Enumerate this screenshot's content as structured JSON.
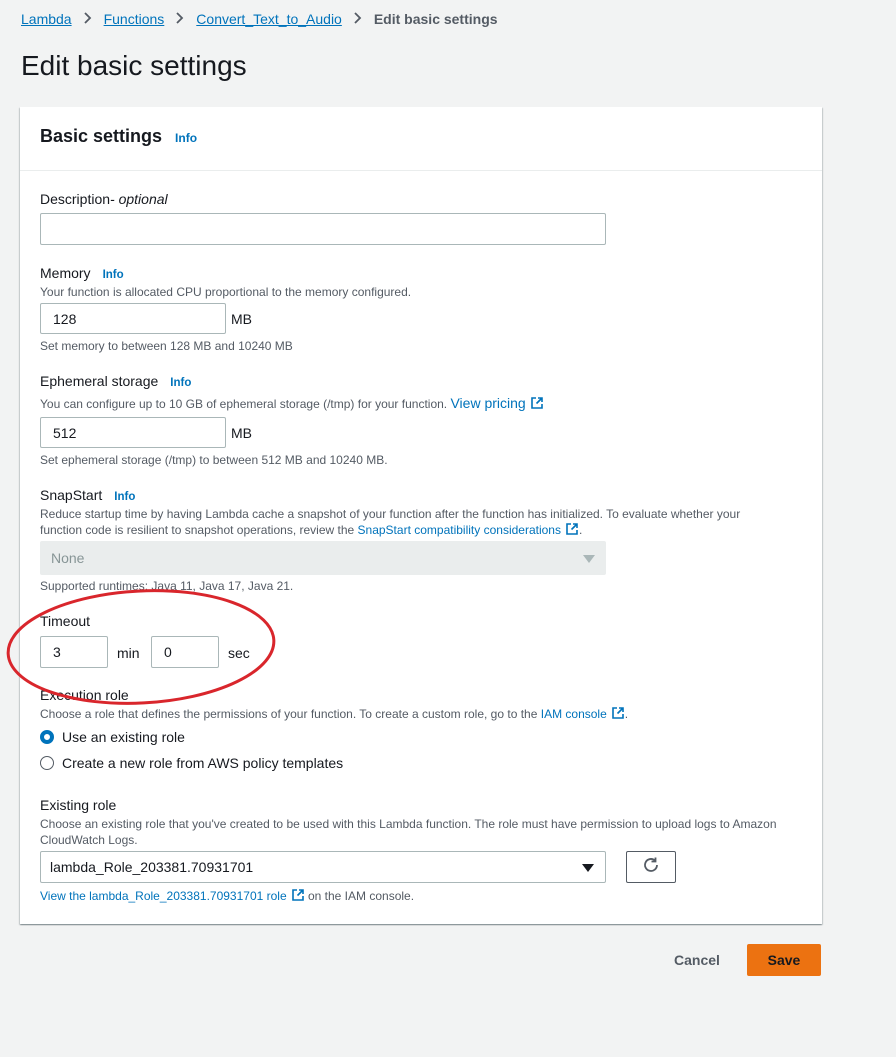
{
  "breadcrumb": {
    "items": [
      "Lambda",
      "Functions",
      "Convert_Text_to_Audio"
    ],
    "current": "Edit basic settings"
  },
  "page": {
    "title": "Edit basic settings"
  },
  "panel": {
    "title": "Basic settings",
    "info": "Info"
  },
  "description": {
    "label": "Description",
    "label_suffix": " - optional",
    "value": ""
  },
  "memory": {
    "label": "Memory",
    "info": "Info",
    "help": "Your function is allocated CPU proportional to the memory configured.",
    "value": "128",
    "unit": "MB",
    "constraint": "Set memory to between 128 MB and 10240 MB"
  },
  "ephemeral": {
    "label": "Ephemeral storage",
    "info": "Info",
    "help": "You can configure up to 10 GB of ephemeral storage (/tmp) for your function.",
    "link": "View pricing",
    "value": "512",
    "unit": "MB",
    "constraint": "Set ephemeral storage (/tmp) to between 512 MB and 10240 MB."
  },
  "snapstart": {
    "label": "SnapStart",
    "info": "Info",
    "help_line1": "Reduce startup time by having Lambda cache a snapshot of your function after the function has initialized. To evaluate whether your",
    "help_line2": "function code is resilient to snapshot operations, review the",
    "link": "SnapStart compatibility considerations",
    "after_link": ".",
    "selected": "None",
    "supported": "Supported runtimes: Java 11, Java 17, Java 21."
  },
  "timeout": {
    "label": "Timeout",
    "min_value": "3",
    "min_unit": "min",
    "sec_value": "0",
    "sec_unit": "sec"
  },
  "execution_role": {
    "label": "Execution role",
    "help": "Choose a role that defines the permissions of your function. To create a custom role, go to the",
    "link": "IAM console",
    "after_link": ".",
    "options": [
      "Use an existing role",
      "Create a new role from AWS policy templates"
    ],
    "selected_index": 0
  },
  "existing_role": {
    "label": "Existing role",
    "help_line1": "Choose an existing role that you've created to be used with this Lambda function. The role must have permission to upload logs to Amazon",
    "help_line2": "CloudWatch Logs.",
    "selected": "lambda_Role_203381.70931701",
    "link": "View the lambda_Role_203381.70931701 role",
    "after_link": "on the IAM console."
  },
  "actions": {
    "cancel": "Cancel",
    "save": "Save"
  },
  "colors": {
    "link": "#0073bb",
    "primary_button": "#ec7211",
    "annotation": "#d9262c",
    "background": "#f2f3f3"
  },
  "icons": {
    "breadcrumb_separator": "chevron-right-icon",
    "external_link": "external-link-icon",
    "dropdown": "caret-down-icon",
    "refresh": "refresh-icon"
  }
}
